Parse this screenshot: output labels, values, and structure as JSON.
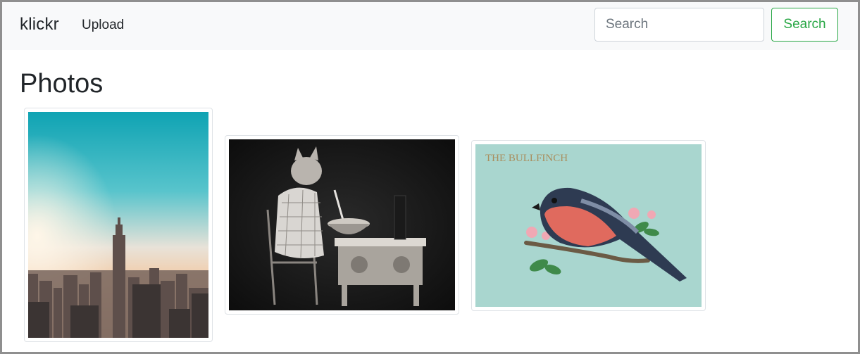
{
  "navbar": {
    "brand": "klickr",
    "links": [
      {
        "label": "Upload"
      }
    ],
    "search": {
      "placeholder": "Search",
      "value": "",
      "button_label": "Search"
    }
  },
  "main": {
    "title": "Photos",
    "photos": [
      {
        "subject": "city skyline at sunrise"
      },
      {
        "subject": "vintage kitten cooking at stove"
      },
      {
        "subject": "bullfinch illustration",
        "caption": "THE BULLFINCH"
      }
    ]
  },
  "colors": {
    "accent": "#28a745",
    "navbar_bg": "#f8f9fa"
  }
}
